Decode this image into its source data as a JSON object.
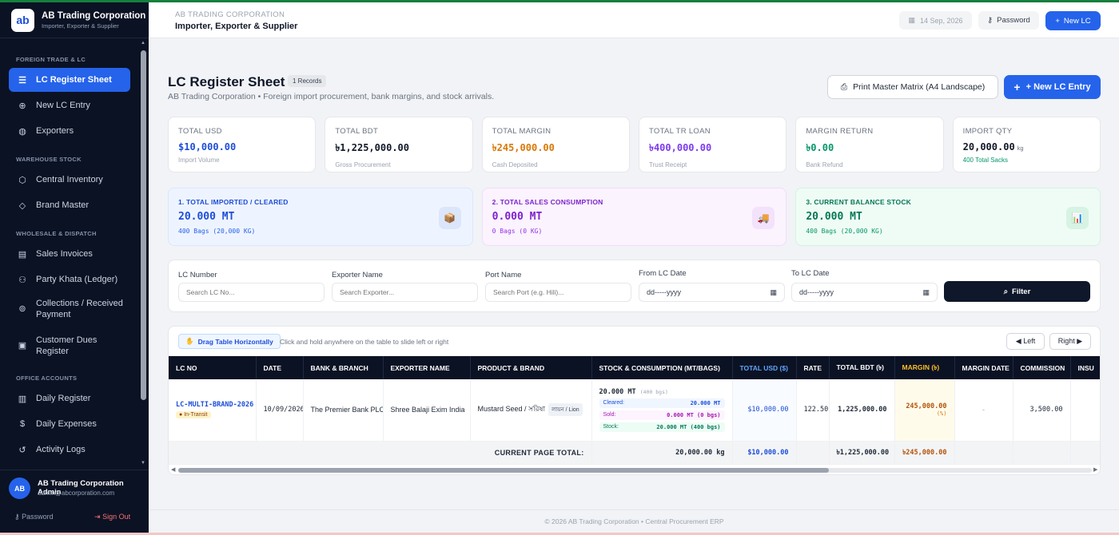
{
  "sidebar": {
    "logo_text": "ab",
    "brand_title": "AB Trading Corporation",
    "brand_sub": "Importer, Exporter & Supplier",
    "sections": [
      {
        "title": "FOREIGN TRADE & LC",
        "items": [
          {
            "label": "LC Register Sheet",
            "icon": "list-icon",
            "active": true
          },
          {
            "label": "New LC Entry",
            "icon": "plus-circle-icon"
          },
          {
            "label": "Exporters",
            "icon": "globe-icon"
          }
        ]
      },
      {
        "title": "WAREHOUSE STOCK",
        "items": [
          {
            "label": "Central Inventory",
            "icon": "box-icon"
          },
          {
            "label": "Brand Master",
            "icon": "tag-icon"
          }
        ]
      },
      {
        "title": "WHOLESALE & DISPATCH",
        "items": [
          {
            "label": "Sales Invoices",
            "icon": "receipt-icon"
          },
          {
            "label": "Party Khata (Ledger)",
            "icon": "users-icon"
          },
          {
            "label": "Collections / Received Payment",
            "icon": "cash-icon"
          },
          {
            "label": "Customer Dues Register",
            "icon": "clipboard-icon"
          }
        ]
      },
      {
        "title": "OFFICE ACCOUNTS",
        "items": [
          {
            "label": "Daily Register",
            "icon": "book-icon"
          },
          {
            "label": "Daily Expenses",
            "icon": "dollar-icon"
          },
          {
            "label": "Activity Logs",
            "icon": "history-icon"
          }
        ]
      }
    ],
    "user": {
      "initials": "AB",
      "name": "AB Trading Corporation Admin",
      "email": "admin@abcorporation.com",
      "password_label": "Password",
      "signout_label": "Sign Out"
    }
  },
  "header": {
    "company": "AB TRADING CORPORATION",
    "tagline": "Importer, Exporter & Supplier",
    "date": "14 Sep, 2026",
    "password_button": "Password",
    "new_lc_button": "New LC"
  },
  "page": {
    "title": "LC Register Sheet",
    "records_badge": "1 Records",
    "subtitle": "AB Trading Corporation • Foreign import procurement, bank margins, and stock arrivals.",
    "print_button": "Print Master Matrix (A4 Landscape)",
    "new_entry_button": "+ New LC Entry"
  },
  "stats": [
    {
      "label": "TOTAL USD",
      "value": "$10,000.00",
      "sub": "Import Volume",
      "color": "#1d4ed8"
    },
    {
      "label": "TOTAL BDT",
      "value": "৳1,225,000.00",
      "sub": "Gross Procurement",
      "color": "#111827"
    },
    {
      "label": "TOTAL MARGIN",
      "value": "৳245,000.00",
      "sub": "Cash Deposited",
      "color": "#d97706"
    },
    {
      "label": "TOTAL TR LOAN",
      "value": "৳400,000.00",
      "sub": "Trust Receipt",
      "color": "#7c3aed"
    },
    {
      "label": "MARGIN RETURN",
      "value": "৳0.00",
      "sub": "Bank Refund",
      "color": "#059669"
    },
    {
      "label": "IMPORT QTY",
      "value": "20,000.00",
      "unit": "kg",
      "sub": "400 Total Sacks",
      "color": "#111827",
      "sub_color": "#059669"
    }
  ],
  "flows": [
    {
      "label": "1. TOTAL IMPORTED / CLEARED",
      "value": "20.000 MT",
      "sub": "400 Bags (20,000 KG)",
      "icon": "box-icon",
      "glyph": "📦",
      "bg": "#eef4ff",
      "border": "#dbe6fd",
      "label_color": "#1d4ed8",
      "sub_color": "#2563eb",
      "icon_bg": "#dbe6fb"
    },
    {
      "label": "2. TOTAL SALES CONSUMPTION",
      "value": "0.000 MT",
      "sub": "0 Bags (0 KG)",
      "icon": "truck-icon",
      "glyph": "🚚",
      "bg": "#fbf3fe",
      "border": "#f1ddfb",
      "label_color": "#7e22ce",
      "sub_color": "#9333ea",
      "icon_bg": "#f3e2fb"
    },
    {
      "label": "3. CURRENT BALANCE STOCK",
      "value": "20.000 MT",
      "sub": "400 Bags (20,000 KG)",
      "icon": "chart-icon",
      "glyph": "📊",
      "bg": "#effcf5",
      "border": "#d3f2e0",
      "label_color": "#047857",
      "sub_color": "#059669",
      "icon_bg": "#d6f3e3"
    }
  ],
  "filters": {
    "lc_number_label": "LC Number",
    "lc_number_placeholder": "Search LC No...",
    "exporter_label": "Exporter Name",
    "exporter_placeholder": "Search Exporter...",
    "port_label": "Port Name",
    "port_placeholder": "Search Port (e.g. Hili)...",
    "from_label": "From LC Date",
    "from_value": "dd-----yyyy",
    "to_label": "To LC Date",
    "to_value": "dd-----yyyy",
    "filter_button": "Filter"
  },
  "table": {
    "drag_chip": "Drag Table Horizontally",
    "drag_hint": "Click and hold anywhere on the table to slide left or right",
    "left_button": "◀ Left",
    "right_button": "Right ▶",
    "columns": [
      "LC NO",
      "DATE",
      "BANK & BRANCH",
      "EXPORTER NAME",
      "PRODUCT & BRAND",
      "STOCK & CONSUMPTION (MT/BAGS)",
      "TOTAL USD ($)",
      "RATE",
      "TOTAL BDT (৳)",
      "MARGIN (৳)",
      "MARGIN DATE",
      "COMMISSION",
      "INSU"
    ],
    "row": {
      "lc_no": "LC-MULTI-BRAND-2026",
      "status": "In-Transit",
      "date": "10/09/2026",
      "bank": "The Premier Bank PLC",
      "exporter": "Shree Balaji Exim India",
      "product": "Mustard Seed / সরিষা",
      "brand": "লায়ন / Lion",
      "stock_main": "20.000 MT",
      "stock_bags": "(400 bgs)",
      "cleared_label": "Cleared:",
      "cleared_value": "20.000 MT",
      "sold_label": "Sold:",
      "sold_value": "0.000 MT (0 bgs)",
      "stock_label": "Stock:",
      "stock_value": "20.000 MT (400 bgs)",
      "total_usd": "$10,000.00",
      "rate": "122.50",
      "total_bdt": "1,225,000.00",
      "margin": "245,000.00",
      "margin_pct": "(%)",
      "margin_date": "-",
      "commission": "3,500.00",
      "insurance": "6,"
    },
    "total_row": {
      "label": "CURRENT PAGE TOTAL:",
      "qty": "20,000.00 kg",
      "usd": "$10,000.00",
      "bdt": "৳1,225,000.00",
      "margin": "৳245,000.00"
    }
  },
  "footer": "© 2026 AB Trading Corporation • Central Procurement ERP"
}
